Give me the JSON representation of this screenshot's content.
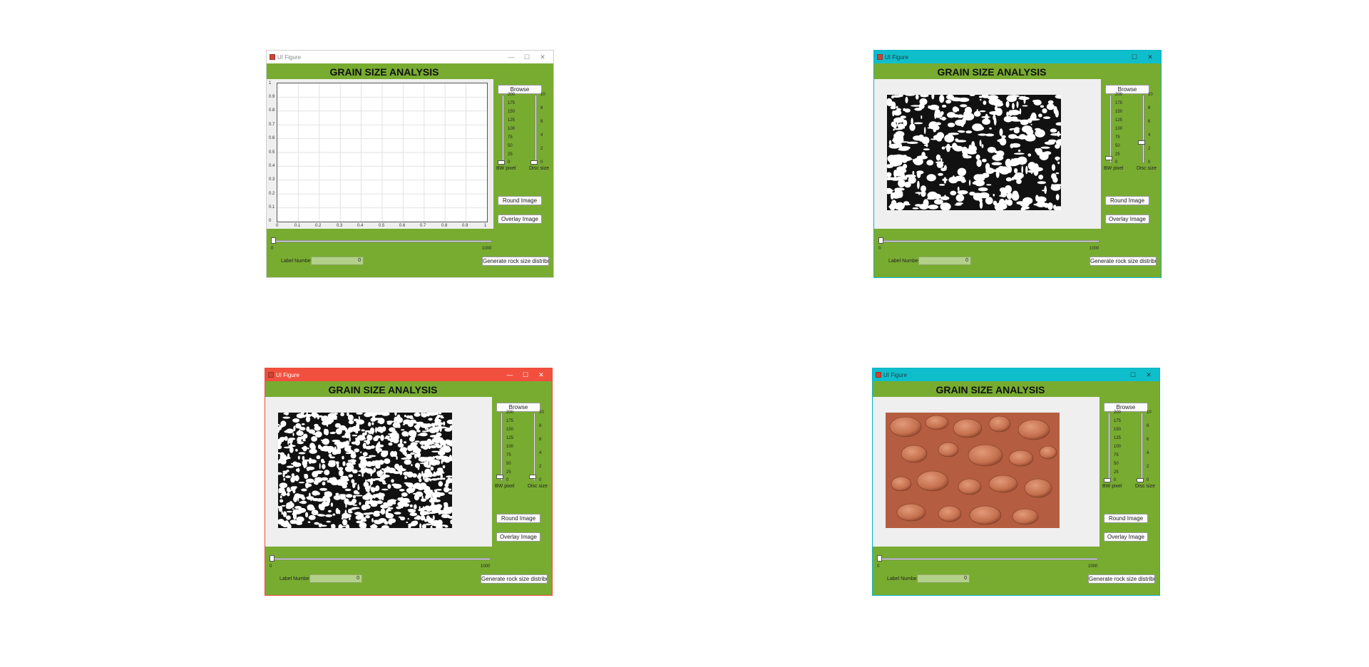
{
  "window_title": "UI Figure",
  "window_controls": {
    "minimize": "—",
    "maximize": "☐",
    "close": "✕"
  },
  "heading": "GRAIN SIZE ANALYSIS",
  "buttons": {
    "browse": "Browse",
    "round_image": "Round Image",
    "overlay_image": "Overlay Image",
    "generate": "Generate rock size distribution"
  },
  "bw_slider": {
    "label": "BW pixel",
    "ticks": [
      "200",
      "175",
      "150",
      "125",
      "100",
      "75",
      "50",
      "25",
      "0"
    ]
  },
  "disc_slider": {
    "label": "Disc size",
    "ticks": [
      "10",
      "8",
      "6",
      "4",
      "2",
      "0"
    ]
  },
  "label_slider": {
    "min": "0",
    "max": "1000"
  },
  "label_number": {
    "label": "Label Number",
    "value": "0"
  },
  "empty_axes": {
    "yticks": [
      "1",
      "0.9",
      "0.8",
      "0.7",
      "0.6",
      "0.5",
      "0.4",
      "0.3",
      "0.2",
      "0.1",
      "0"
    ],
    "xticks": [
      "0",
      "0.1",
      "0.2",
      "0.3",
      "0.4",
      "0.5",
      "0.6",
      "0.7",
      "0.8",
      "0.9",
      "1"
    ]
  },
  "window_states": [
    {
      "name": "empty-axes",
      "titlebar_color": "#ffffff",
      "disc_level": 0.0,
      "bw_level": 0.0
    },
    {
      "name": "binary-image",
      "titlebar_color": "#0fbecb",
      "disc_level": 0.3,
      "bw_level": 0.06
    },
    {
      "name": "binary-image-detailed",
      "titlebar_color": "#f2503e",
      "disc_level": 0.05,
      "bw_level": 0.05
    },
    {
      "name": "original-soil-image",
      "titlebar_color": "#0fbecb",
      "disc_level": 0.0,
      "bw_level": 0.0
    }
  ]
}
